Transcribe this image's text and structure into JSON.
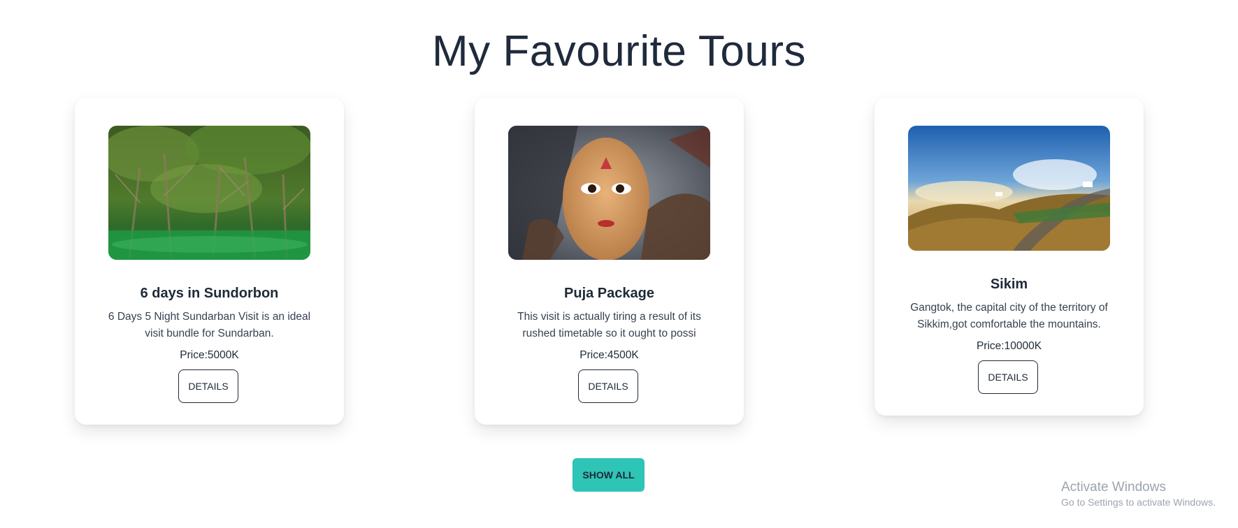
{
  "page": {
    "title": "My Favourite Tours"
  },
  "tours": [
    {
      "title": "6 days in Sundorbon",
      "description": "6 Days 5 Night Sundarban Visit is an ideal visit bundle for Sundarban.",
      "price": "Price:5000K",
      "button_label": "DETAILS"
    },
    {
      "title": "Puja Package",
      "description": "This visit is actually tiring a result of its rushed timetable so it ought to possi",
      "price": "Price:4500K",
      "button_label": "DETAILS"
    },
    {
      "title": "Sikim",
      "description": "Gangtok, the capital city of the territory of Sikkim,got comfortable the mountains.",
      "price": "Price:10000K",
      "button_label": "DETAILS"
    }
  ],
  "show_all": {
    "label": "SHOW ALL"
  },
  "watermark": {
    "title": "Activate Windows",
    "subtitle": "Go to Settings to activate Windows."
  },
  "colors": {
    "accent": "#2ec4b6",
    "text": "#1f2937"
  }
}
